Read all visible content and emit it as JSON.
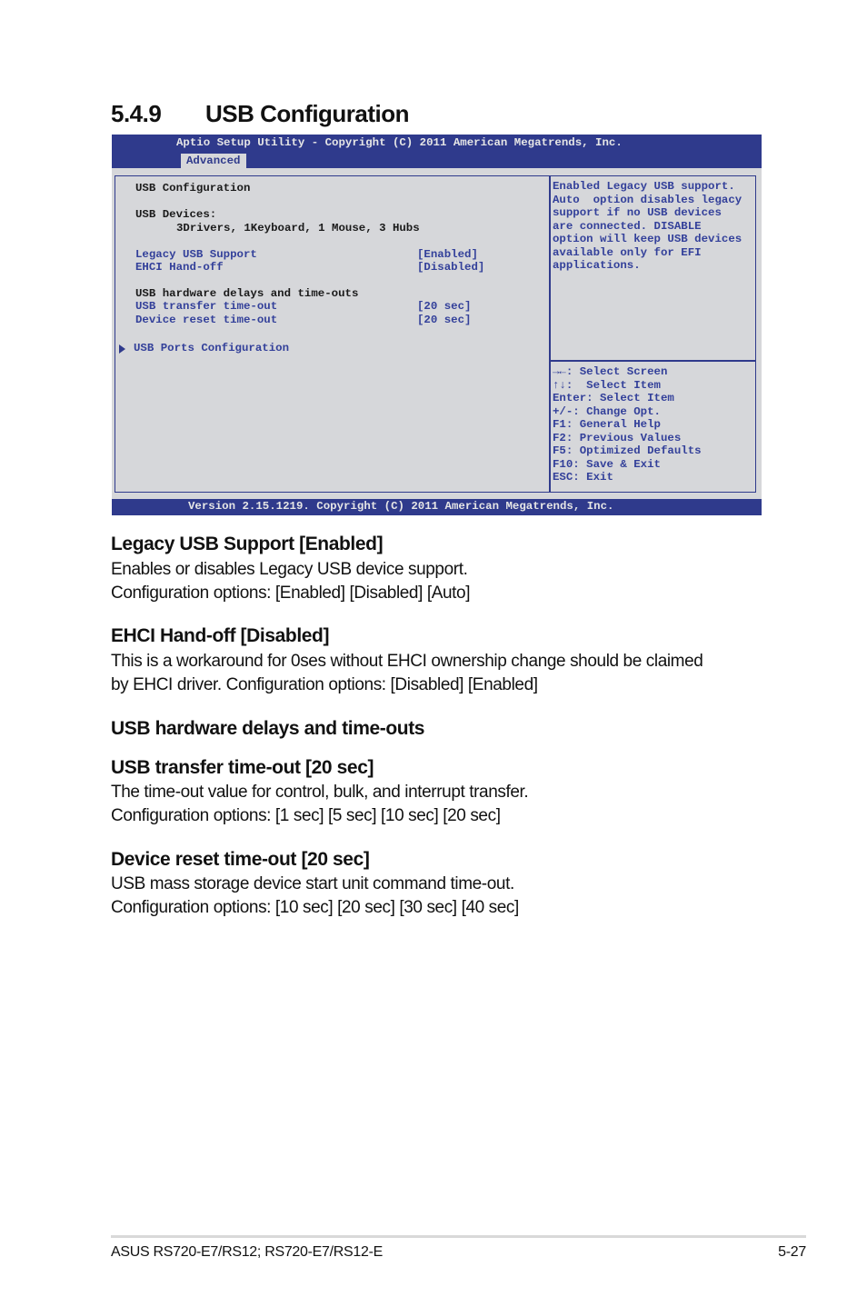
{
  "section": {
    "number": "5.4.9",
    "title": "USB Configuration"
  },
  "bios": {
    "header_title": "Aptio Setup Utility - Copyright (C) 2011 American Megatrends, Inc.",
    "active_tab": "Advanced",
    "main": {
      "heading": "USB Configuration",
      "devices_label": "USB Devices:",
      "devices_value": "3Drivers, 1Keyboard, 1 Mouse, 3 Hubs",
      "settings": [
        {
          "label": "Legacy USB Support",
          "value": "[Enabled]"
        },
        {
          "label": "EHCI Hand-off",
          "value": "[Disabled]"
        }
      ],
      "delays_heading": "USB hardware delays and time-outs",
      "timeouts": [
        {
          "label": "USB transfer time-out",
          "value": "[20 sec]"
        },
        {
          "label": "Device reset time-out",
          "value": "[20 sec]"
        }
      ],
      "submenu": "USB Ports Configuration"
    },
    "help_text": [
      "Enabled Legacy USB support.",
      "Auto  option disables legacy",
      "support if no USB devices",
      "are connected. DISABLE",
      "option will keep USB devices",
      "available only for EFI",
      "applications."
    ],
    "key_help": [
      "→←: Select Screen",
      "↑↓:  Select Item",
      "Enter: Select Item",
      "+/-: Change Opt.",
      "F1: General Help",
      "F2: Previous Values",
      "F5: Optimized Defaults",
      "F10: Save & Exit",
      "ESC: Exit"
    ],
    "footer_version": "Version 2.15.1219. Copyright (C) 2011 American Megatrends, Inc.",
    "colors": {
      "bar": "#2f3a8c",
      "panel": "#d6d7da",
      "option_text": "#33409a"
    }
  },
  "doc": {
    "items": [
      {
        "heading": "Legacy USB Support [Enabled]",
        "lines": [
          "Enables or disables Legacy USB device support.",
          "Configuration options: [Enabled] [Disabled] [Auto]"
        ]
      },
      {
        "heading": "EHCI Hand-off [Disabled]",
        "lines": [
          "This is a workaround for 0ses without EHCI ownership change should be claimed",
          "by EHCI driver. Configuration options: [Disabled] [Enabled]"
        ]
      },
      {
        "heading": "USB hardware delays and time-outs",
        "lines": []
      },
      {
        "heading": "USB transfer time-out [20 sec]",
        "lines": [
          "The time-out value for control, bulk, and interrupt transfer.",
          "Configuration options: [1 sec] [5 sec] [10 sec] [20 sec]"
        ]
      },
      {
        "heading": "Device reset time-out [20 sec]",
        "lines": [
          "USB mass storage device start unit command time-out.",
          "Configuration options: [10 sec] [20 sec] [30 sec] [40 sec]"
        ]
      }
    ]
  },
  "footer": {
    "product": "ASUS RS720-E7/RS12; RS720-E7/RS12-E",
    "page": "5-27"
  }
}
